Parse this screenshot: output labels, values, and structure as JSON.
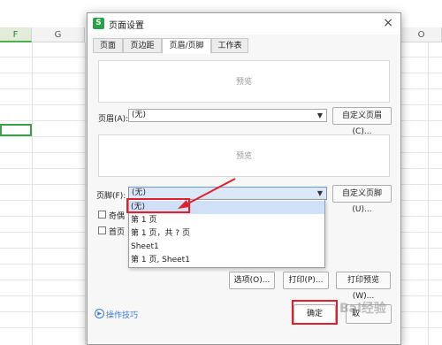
{
  "spreadsheet": {
    "columns": [
      {
        "name": "F",
        "selected": true
      },
      {
        "name": "G",
        "selected": false
      },
      {
        "name": "O",
        "selected": false
      }
    ]
  },
  "dialog": {
    "app_icon": "S",
    "title": "页面设置",
    "close_icon": "×",
    "tabs": [
      {
        "label": "页面",
        "active": false
      },
      {
        "label": "页边距",
        "active": false
      },
      {
        "label": "页眉/页脚",
        "active": true
      },
      {
        "label": "工作表",
        "active": false
      }
    ],
    "header_preview": "预览",
    "header_label": "页眉(A):",
    "header_value": "(无)",
    "custom_header_button": "自定义页眉(C)...",
    "footer_preview": "预览",
    "footer_label": "页脚(F):",
    "footer_value": "(无)",
    "custom_footer_button": "自定义页脚(U)...",
    "checkbox_odd_even": "奇偶",
    "checkbox_first_page": "首页",
    "footer_options": [
      "(无)",
      "第 1 页",
      "第 1 页，共 ? 页",
      "Sheet1",
      "第 1 页, Sheet1"
    ],
    "options_button": "选项(O)...",
    "print_button": "打印(P)...",
    "print_preview_button": "打印预览(W)...",
    "tips_link": "操作技巧",
    "ok_button": "确定",
    "cancel_button_partial": "取"
  },
  "watermark": "Bai经验",
  "colors": {
    "highlight": "#e0202a",
    "accent": "#27a34a"
  }
}
